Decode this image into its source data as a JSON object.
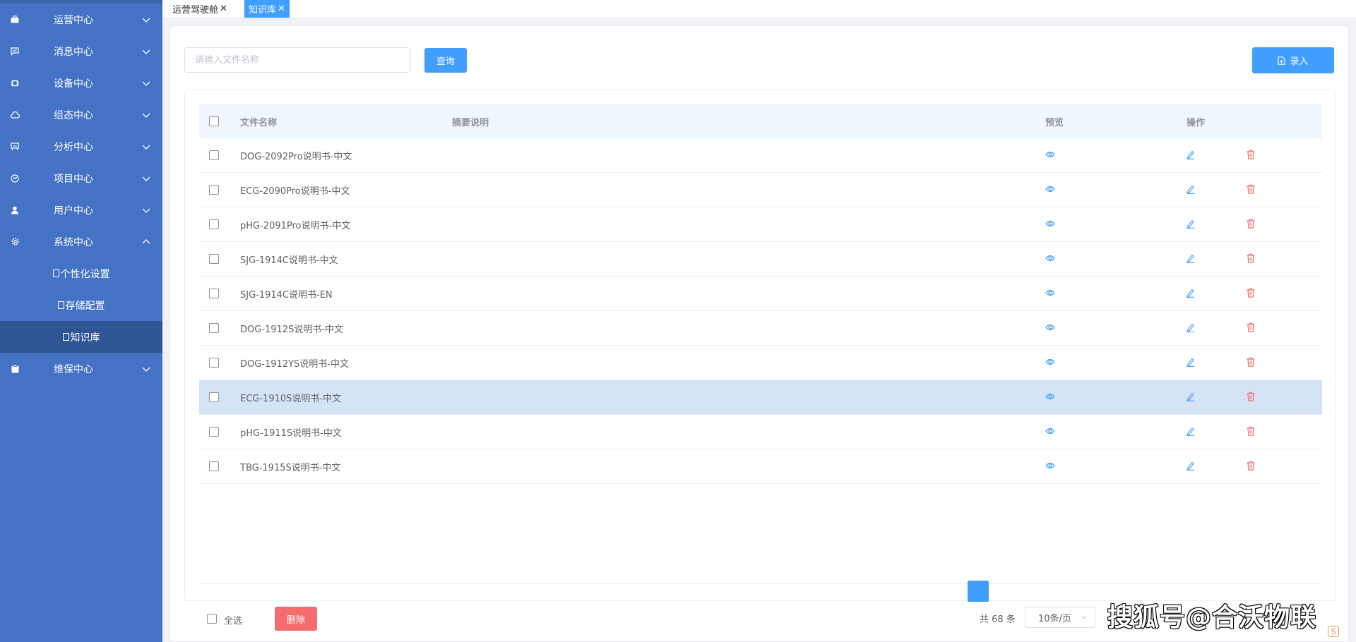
{
  "sidebar": {
    "items": [
      {
        "label": "运营中心",
        "icon": "briefcase-icon",
        "expanded": false
      },
      {
        "label": "消息中心",
        "icon": "message-icon",
        "expanded": false
      },
      {
        "label": "设备中心",
        "icon": "device-icon",
        "expanded": false
      },
      {
        "label": "组态中心",
        "icon": "cloud-icon",
        "expanded": false
      },
      {
        "label": "分析中心",
        "icon": "chart-board-icon",
        "expanded": false
      },
      {
        "label": "项目中心",
        "icon": "dashboard-icon",
        "expanded": false
      },
      {
        "label": "用户中心",
        "icon": "user-icon",
        "expanded": false
      },
      {
        "label": "系统中心",
        "icon": "gear-icon",
        "expanded": true
      },
      {
        "label": "维保中心",
        "icon": "clipboard-icon",
        "expanded": false
      }
    ],
    "sub_items": [
      {
        "label": "个性化设置",
        "active": false
      },
      {
        "label": "存储配置",
        "active": false
      },
      {
        "label": "知识库",
        "active": true
      }
    ]
  },
  "tabs": [
    {
      "label": "运营驾驶舱",
      "active": false
    },
    {
      "label": "知识库",
      "active": true
    }
  ],
  "search": {
    "placeholder": "请输入文件名称",
    "value": ""
  },
  "buttons": {
    "query": "查询",
    "enter": "录入",
    "delete": "删除"
  },
  "table": {
    "headers": {
      "name": "文件名称",
      "desc": "摘要说明",
      "preview": "预览",
      "ops": "操作"
    },
    "rows": [
      {
        "name": "DOG-2092Pro说明书-中文",
        "desc": ""
      },
      {
        "name": "ECG-2090Pro说明书-中文",
        "desc": ""
      },
      {
        "name": "pHG-2091Pro说明书-中文",
        "desc": ""
      },
      {
        "name": "SJG-1914C说明书-中文",
        "desc": ""
      },
      {
        "name": "SJG-1914C说明书-EN",
        "desc": ""
      },
      {
        "name": "DOG-1912S说明书-中文",
        "desc": ""
      },
      {
        "name": "DOG-1912YS说明书-中文",
        "desc": ""
      },
      {
        "name": "ECG-1910S说明书-中文",
        "desc": ""
      },
      {
        "name": "pHG-1911S说明书-中文",
        "desc": ""
      },
      {
        "name": "TBG-1915S说明书-中文",
        "desc": ""
      }
    ],
    "highlighted_row": 7
  },
  "footer": {
    "select_all": "全选",
    "total": "共 68 条",
    "page_size": "10条/页"
  },
  "watermark": "搜狐号@合沃物联",
  "colors": {
    "sidebar": "#4472c4",
    "sidebar_active": "#2f5597",
    "primary": "#409eff",
    "danger": "#f56c6c",
    "highlight_row": "#d4e4f6"
  }
}
